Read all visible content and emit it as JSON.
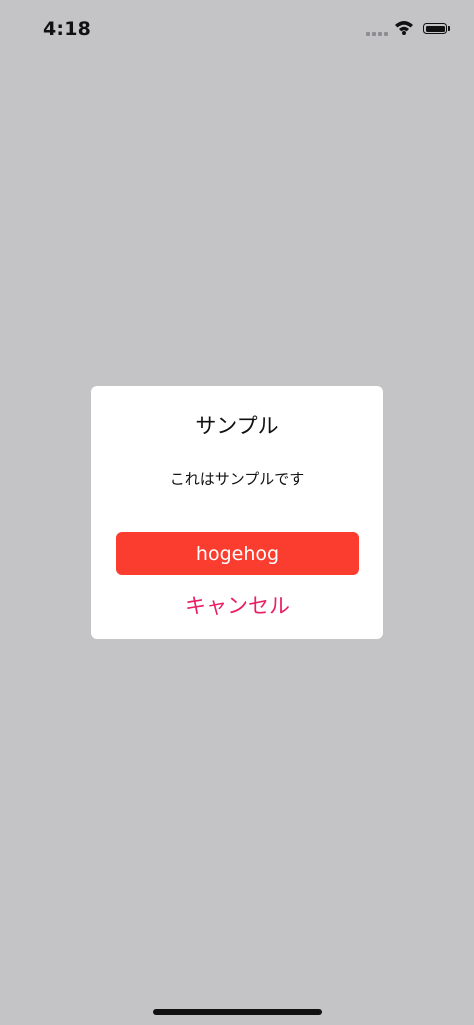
{
  "status_bar": {
    "time": "4:18",
    "icons": [
      "cellular-signal-icon",
      "wifi-icon",
      "battery-icon"
    ]
  },
  "dialog": {
    "title": "サンプル",
    "message": "これはサンプルです",
    "primary_button_label": "hogehog",
    "cancel_button_label": "キャンセル"
  },
  "colors": {
    "background": "#c4c4c6",
    "dialog_background": "#ffffff",
    "primary_button": "#fb3d30",
    "cancel_text": "#e91e63"
  }
}
